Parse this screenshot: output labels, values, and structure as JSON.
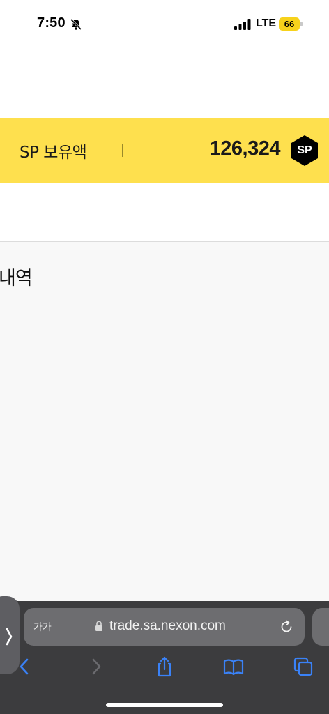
{
  "status_bar": {
    "time": "7:50",
    "network": "LTE",
    "battery": "66",
    "icons": [
      "bell-slash-icon",
      "signal-icon"
    ]
  },
  "sp_balance": {
    "label": "SP 보유액",
    "amount": "126,324",
    "badge": "SP",
    "colors": {
      "banner": "#fee04e",
      "badge": "#000000"
    }
  },
  "history": {
    "title": "내역"
  },
  "browser": {
    "text_size_label": "가가",
    "url": "trade.sa.nexon.com",
    "icons": [
      "chevron-right-icon",
      "lock-icon",
      "reload-icon",
      "back-icon",
      "forward-icon",
      "share-icon",
      "bookmarks-icon",
      "tabs-icon"
    ],
    "colors": {
      "toolbar": "#3c3c3e",
      "accent": "#3a82f7"
    }
  }
}
